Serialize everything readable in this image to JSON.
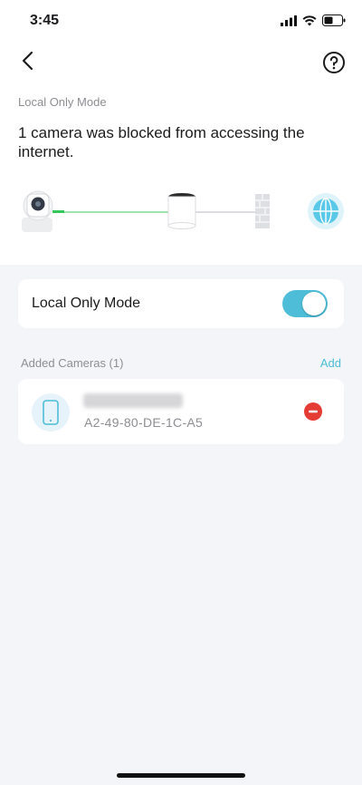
{
  "status": {
    "time": "3:45"
  },
  "header": {
    "back_icon": "chevron-left-icon",
    "help_icon": "question-circle-icon"
  },
  "page": {
    "subtitle": "Local Only Mode",
    "headline": "1 camera was blocked from accessing the internet."
  },
  "diagram": {
    "items": [
      "camera-icon",
      "router-icon",
      "firewall-icon",
      "globe-icon"
    ],
    "connected_color": "#7fdc94",
    "blocked_color": "#cfd2d6"
  },
  "toggle": {
    "label": "Local Only Mode",
    "state": "on"
  },
  "cameras": {
    "section_label": "Added Cameras (1)",
    "add_label": "Add",
    "items": [
      {
        "name": "",
        "mac": "A2-49-80-DE-1C-A5",
        "icon": "phone-icon"
      }
    ]
  },
  "colors": {
    "accent": "#4dbdd8",
    "danger": "#e53b35"
  }
}
